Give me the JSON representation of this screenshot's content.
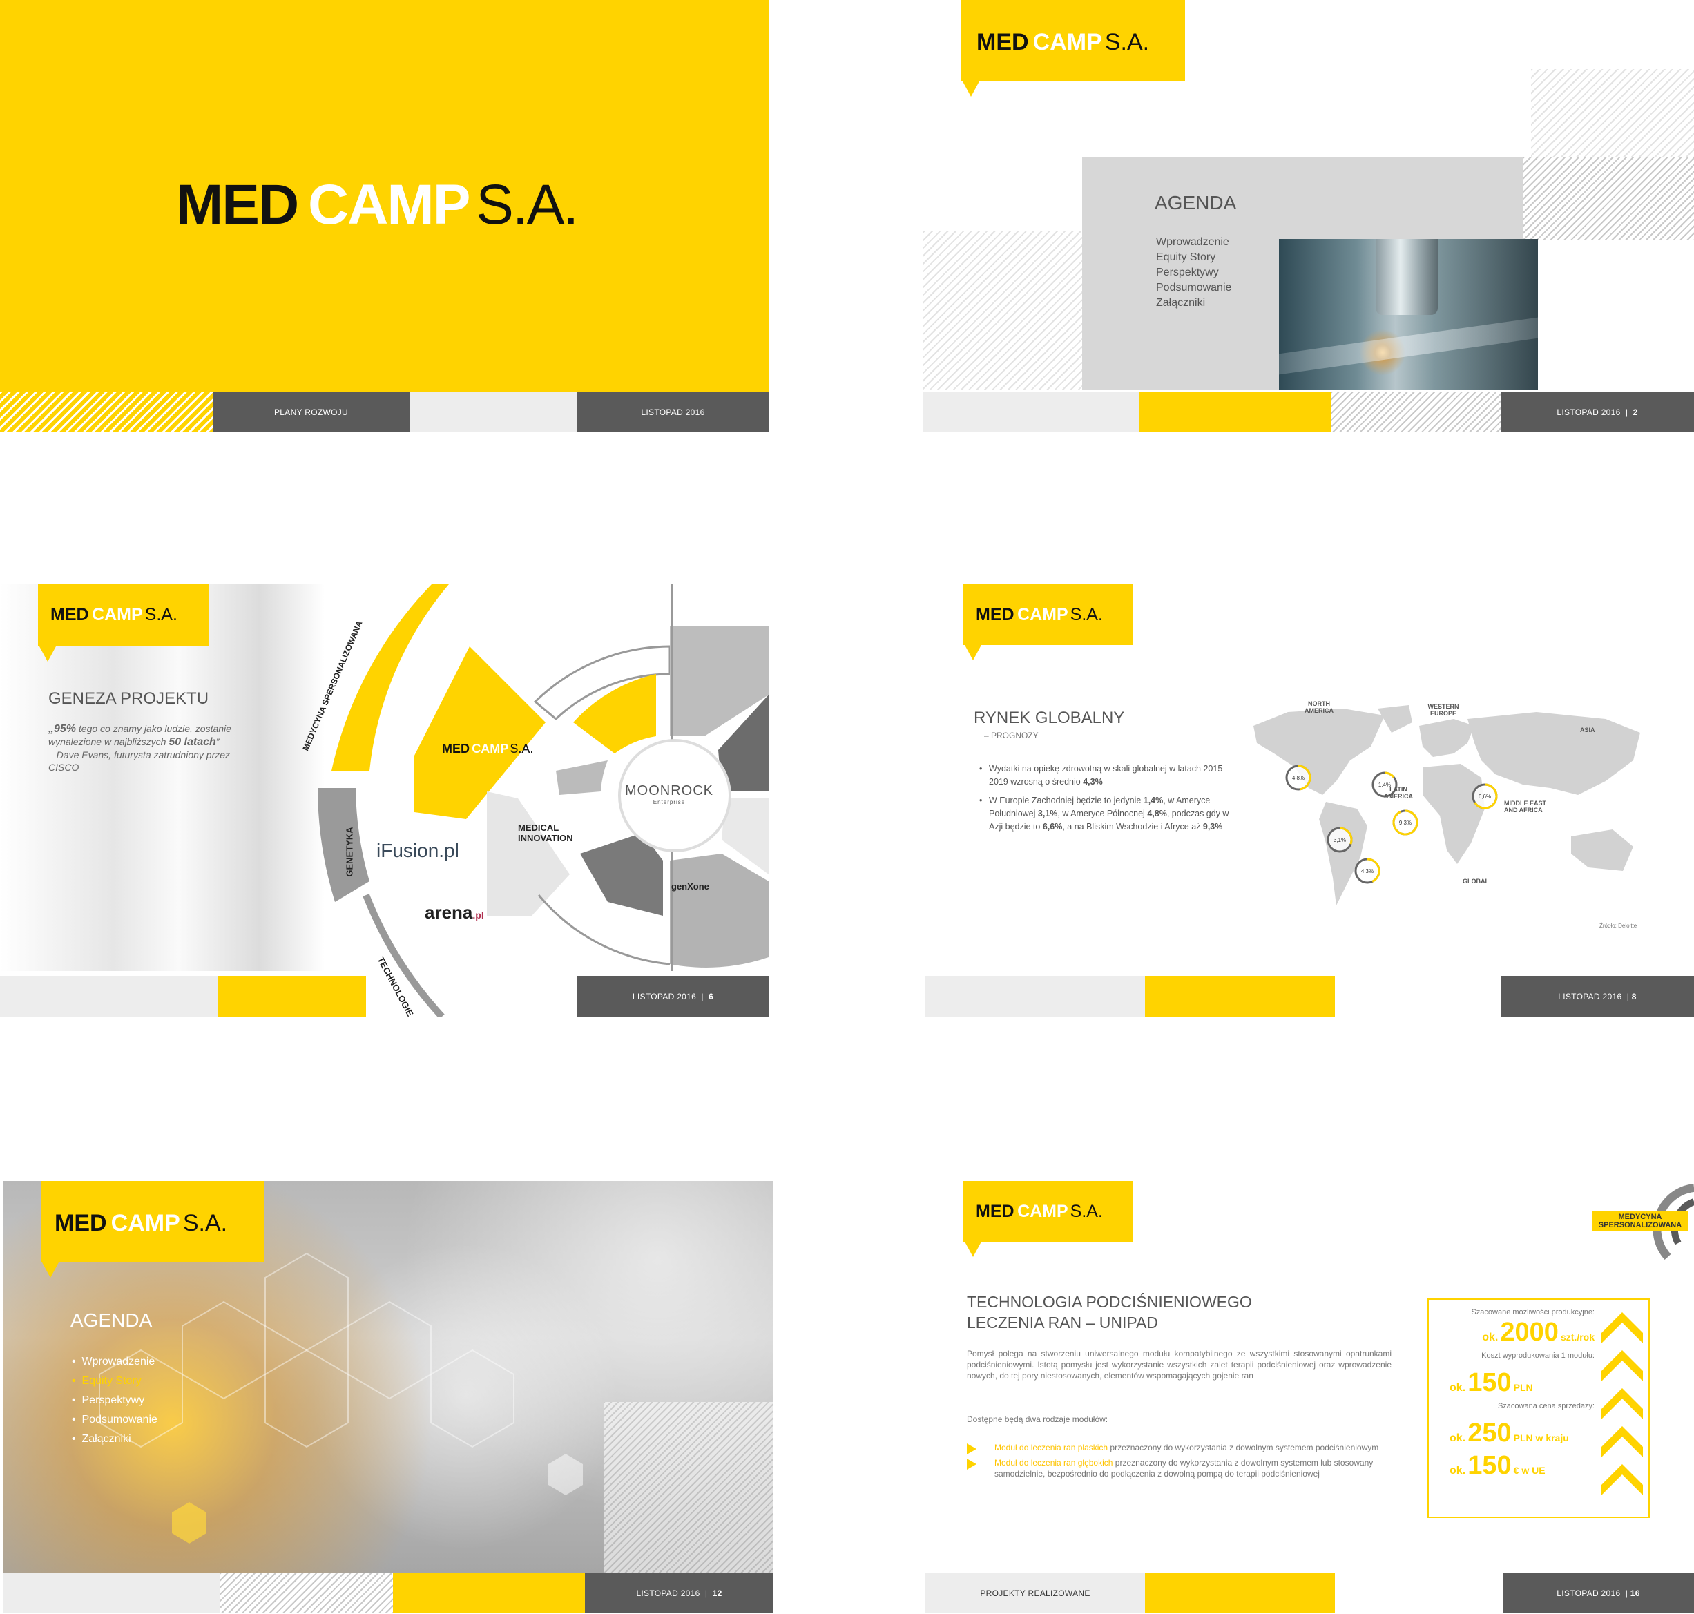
{
  "brand": {
    "med": "MED",
    "camp": "CAMP",
    "sa": "S.A."
  },
  "slide1": {
    "footer_left": "PLANY ROZWOJU",
    "footer_right": "LISTOPAD 2016"
  },
  "slide2": {
    "title": "AGENDA",
    "items": [
      "Wprowadzenie",
      "Equity Story",
      "Perspektywy",
      "Podsumowanie",
      "Załączniki"
    ],
    "footer": "LISTOPAD 2016",
    "sep": "|",
    "page": "2"
  },
  "slide3": {
    "title": "GENEZA PROJEKTU",
    "quote_pre": "„95%",
    "quote_mid": " tego co znamy jako ludzie, zostanie wynalezione w najbliższych ",
    "quote_bold": "50 latach",
    "quote_end": "”",
    "attribution": "– Dave Evans, futurysta zatrudniony przez CISCO",
    "arc_labels": [
      "MEDYCYNA SPERSONALIZOWANA",
      "GENETYKA",
      "TECHNOLOGIE"
    ],
    "logos": {
      "ifusion": "iFusion.pl",
      "arena": "arena",
      "arena_suffix": ".pl",
      "moonrock": "MOONROCK",
      "moonrock_sub": "Enterprise",
      "medical": "MEDICAL INNOVATION",
      "genxone": "genXone"
    },
    "footer": "LISTOPAD 2016",
    "sep": "|",
    "page": "6"
  },
  "slide4": {
    "title": "RYNEK GLOBALNY",
    "subtitle": "– PROGNOZY",
    "bullets": [
      {
        "text_pre": "Wydatki na opiekę zdrowotną w skali globalnej w latach 2015-2019 wzrosną o średnio ",
        "bold": "4,3%"
      },
      {
        "text_pre": "W Europie Zachodniej będzie to jedynie ",
        "b1": "1,4%",
        "m1": ", w Ameryce Południowej ",
        "b2": "3,1%",
        "m2": ", w Ameryce Północnej ",
        "b3": "4,8%",
        "m3": ", podczas gdy w Azji będzie to ",
        "b4": "6,6%",
        "m4": ", a na Bliskim Wschodzie i Afryce aż ",
        "b5": "9,3%"
      }
    ],
    "regions": [
      {
        "name": "NORTH AMERICA",
        "value": "4,8%",
        "pct": 0.48
      },
      {
        "name": "WESTERN EUROPE",
        "value": "1,4%",
        "pct": 0.14
      },
      {
        "name": "ASIA",
        "value": "6,6%",
        "pct": 0.66
      },
      {
        "name": "LATIN AMERICA",
        "value": "3,1%",
        "pct": 0.31
      },
      {
        "name": "MIDDLE EAST AND AFRICA",
        "value": "9,3%",
        "pct": 0.93
      },
      {
        "name": "GLOBAL",
        "value": "4,3%",
        "pct": 0.43
      }
    ],
    "source": "Źródło: Deloitte",
    "footer": "LISTOPAD 2016",
    "sep": "|",
    "page": "8"
  },
  "slide5": {
    "title": "AGENDA",
    "items": [
      "Wprowadzenie",
      "Equity Story",
      "Perspektywy",
      "Podsumowanie",
      "Załączniki"
    ],
    "active_index": 1,
    "footer": "LISTOPAD 2016",
    "sep": "|",
    "page": "12"
  },
  "slide6": {
    "title1": "TECHNOLOGIA PODCIŚNIENIOWEGO",
    "title2": "LECZENIA RAN – UNIPAD",
    "para": "Pomysł polega na stworzeniu uniwersalnego modułu kompatybilnego ze wszystkimi stosowanymi opatrunkami podciśnieniowymi. Istotą pomysłu jest wykorzystanie wszystkich zalet terapii podciśnieniowej oraz wprowadzenie nowych, do tej pory niestosowanych, elementów wspomagających gojenie ran",
    "modules_intro": "Dostępne będą dwa rodzaje modułów:",
    "modules": [
      {
        "bold": "Moduł do leczenia ran płaskich",
        "rest": " przeznaczony do wykorzystania z dowolnym systemem podciśnieniowym"
      },
      {
        "bold": "Moduł do leczenia ran głębokich",
        "rest": " przeznaczony do wykorzystania z dowolnym systemem lub stosowany samodzielnie, bezpośrednio do podłączenia z dowolną pompą do terapii podciśnieniowej"
      }
    ],
    "badge": "MEDYCYNA SPERSONALIZOWANA",
    "box": {
      "l1": "Szacowane możliwości produkcyjne:",
      "v1_pre": "ok.",
      "v1": "2000",
      "v1_unit": "szt./rok",
      "l2": "Koszt wyprodukowania 1 modułu:",
      "v2_pre": "ok.",
      "v2": "150",
      "v2_unit": "PLN",
      "l3": "Szacowana cena sprzedaży:",
      "v3_pre": "ok.",
      "v3": "250",
      "v3_unit": "PLN w kraju",
      "v4_pre": "ok.",
      "v4": "150",
      "v4_unit": "€ w UE"
    },
    "footer_left": "PROJEKTY REALIZOWANE",
    "footer": "LISTOPAD 2016",
    "sep": "|",
    "page": "16"
  },
  "colors": {
    "yellow": "#ffd300",
    "dark_gray": "#5a5a5a",
    "light_gray": "#ededed"
  }
}
